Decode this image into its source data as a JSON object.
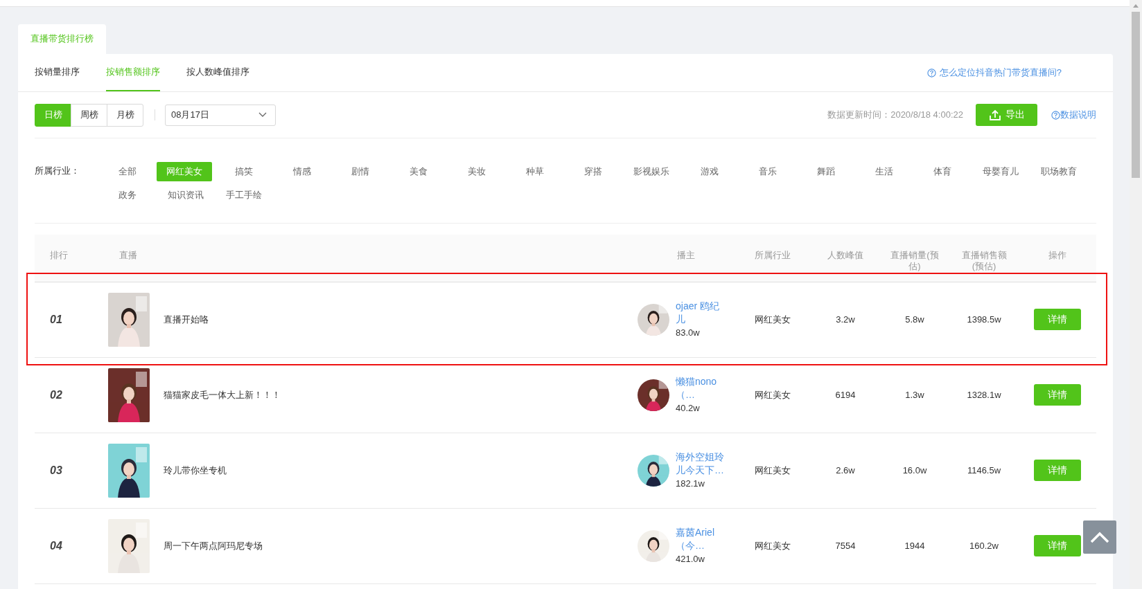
{
  "page_tab": {
    "label": "直播带货排行榜",
    "selected": true
  },
  "sort_tabs": [
    {
      "label": "按销量排序",
      "selected": false
    },
    {
      "label": "按销售额排序",
      "selected": true
    },
    {
      "label": "按人数峰值排序",
      "selected": false
    }
  ],
  "help_link": "怎么定位抖音热门带货直播间?",
  "period_tabs": [
    {
      "label": "日榜",
      "selected": true
    },
    {
      "label": "周榜",
      "selected": false
    },
    {
      "label": "月榜",
      "selected": false
    }
  ],
  "date_select": {
    "value": "08月17日"
  },
  "update_time": "数据更新时间：2020/8/18 4:00:22",
  "export_button": "导出",
  "data_note_link": "数据说明",
  "industry": {
    "label": "所属行业：",
    "options": [
      {
        "label": "全部",
        "selected": false
      },
      {
        "label": "网红美女",
        "selected": true
      },
      {
        "label": "搞笑",
        "selected": false
      },
      {
        "label": "情感",
        "selected": false
      },
      {
        "label": "剧情",
        "selected": false
      },
      {
        "label": "美食",
        "selected": false
      },
      {
        "label": "美妆",
        "selected": false
      },
      {
        "label": "种草",
        "selected": false
      },
      {
        "label": "穿搭",
        "selected": false
      },
      {
        "label": "影视娱乐",
        "selected": false
      },
      {
        "label": "游戏",
        "selected": false
      },
      {
        "label": "音乐",
        "selected": false
      },
      {
        "label": "舞蹈",
        "selected": false
      },
      {
        "label": "生活",
        "selected": false
      },
      {
        "label": "体育",
        "selected": false
      },
      {
        "label": "母婴育儿",
        "selected": false
      },
      {
        "label": "职场教育",
        "selected": false
      },
      {
        "label": "政务",
        "selected": false
      },
      {
        "label": "知识资讯",
        "selected": false
      },
      {
        "label": "手工手绘",
        "selected": false
      }
    ]
  },
  "table": {
    "columns": [
      "排行",
      "直播",
      "播主",
      "所属行业",
      "人数峰值",
      "直播销量(预估)",
      "直播销售额(预估)",
      "操作"
    ],
    "rows": [
      {
        "rank": "01",
        "title": "直播开始咯",
        "anchor_name": "ojaer 鸥纪儿",
        "anchor_fans": "83.0w",
        "industry": "网红美女",
        "peak": "3.2w",
        "volume": "5.8w",
        "sales": "1398.5w",
        "action": "详情",
        "highlighted": true
      },
      {
        "rank": "02",
        "title": "猫猫家皮毛一体大上新！！！",
        "anchor_name": "懒猫nono（…",
        "anchor_fans": "40.2w",
        "industry": "网红美女",
        "peak": "6194",
        "volume": "1.3w",
        "sales": "1328.1w",
        "action": "详情",
        "highlighted": false
      },
      {
        "rank": "03",
        "title": "玲儿带你坐专机",
        "anchor_name": "海外空姐玲儿今天下…",
        "anchor_fans": "182.1w",
        "industry": "网红美女",
        "peak": "2.6w",
        "volume": "16.0w",
        "sales": "1146.5w",
        "action": "详情",
        "highlighted": false
      },
      {
        "rank": "04",
        "title": "周一下午两点阿玛尼专场",
        "anchor_name": "嘉茵Ariel（今…",
        "anchor_fans": "421.0w",
        "industry": "网红美女",
        "peak": "7554",
        "volume": "1944",
        "sales": "160.2w",
        "action": "详情",
        "highlighted": false
      }
    ]
  }
}
